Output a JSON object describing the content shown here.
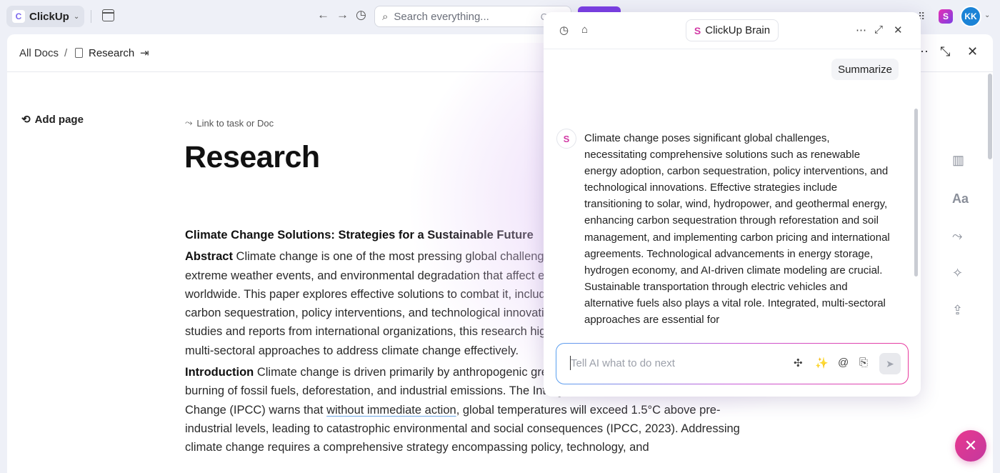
{
  "topbar": {
    "app_name": "ClickUp",
    "logo_letter": "C",
    "search_placeholder": "Search everything...",
    "search_shortcut": "Ctrl",
    "avatar_initials": "KK",
    "brain_tile_glyph": "S"
  },
  "doc": {
    "breadcrumb_root": "All Docs",
    "breadcrumb_sep": "/",
    "breadcrumb_current": "Research",
    "add_page_label": "Add page",
    "link_task_label": "Link to task or Doc",
    "title": "Research",
    "heading": "Climate Change Solutions: Strategies for a Sustainable Future",
    "abstract_label": "Abstract",
    "abstract_text": " Climate change is one of the most pressing global challenges, causing rising temperatures, extreme weather events, and environmental degradation that affect ecosystems, health, and economies worldwide. This paper explores effective solutions to combat it, including renewable energy adoption, carbon sequestration, policy interventions, and technological innovations. Drawing from peer-reviewed studies and reports from international organizations, this research highlights the necessity of integrated, multi-sectoral approaches to address climate change effectively.",
    "intro_label": "Introduction",
    "intro_text_a": " Climate change is driven primarily by anthropogenic greenhouse gas emissions from the burning of fossil fuels, deforestation, and industrial emissions. The Intergovernmental Panel on Climate Change (IPCC) warns that ",
    "intro_underlined": "without immediate action",
    "intro_text_b": ", global temperatures will exceed 1.5°C above pre-industrial levels, leading to catastrophic environmental and social consequences (IPCC, 2023). Addressing climate change requires a comprehensive strategy encompassing policy, technology, and"
  },
  "brain": {
    "tab_label": "ClickUp Brain",
    "tab_glyph": "S",
    "summarize_chip": "Summarize",
    "response": "Climate change poses significant global challenges, necessitating comprehensive solutions such as renewable energy adoption, carbon sequestration, policy interventions, and technological innovations. Effective strategies include transitioning to solar, wind, hydropower, and geothermal energy, enhancing carbon sequestration through reforestation and soil management, and implementing carbon pricing and international agreements. Technological advancements in energy storage, hydrogen economy, and AI-driven climate modeling are crucial. Sustainable transportation through electric vehicles and alternative fuels also plays a vital role. Integrated, multi-sectoral approaches are essential for",
    "prompt_placeholder": "Tell AI what to do next"
  }
}
